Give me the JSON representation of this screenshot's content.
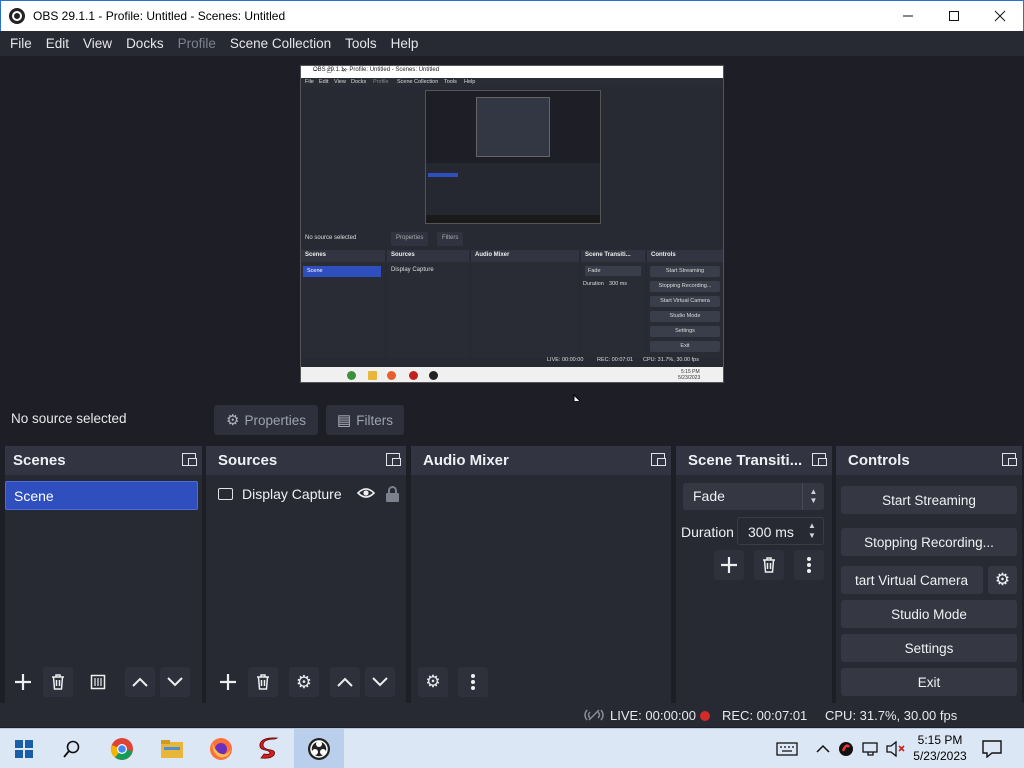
{
  "window": {
    "title": "OBS 29.1.1 - Profile: Untitled - Scenes: Untitled",
    "minimize_icon": "minimize-icon",
    "maximize_icon": "maximize-icon",
    "close_icon": "close-icon"
  },
  "menu": {
    "items": [
      "File",
      "Edit",
      "View",
      "Docks",
      "Profile",
      "Scene Collection",
      "Tools",
      "Help"
    ],
    "disabled": [
      "Profile"
    ]
  },
  "preview": {
    "title": "OBS 29.1.1 - Profile: Untitled - Scenes: Untitled",
    "menu": [
      "File",
      "Edit",
      "View",
      "Docks",
      "Profile",
      "Scene Collection",
      "Tools",
      "Help"
    ],
    "no_source": "No source selected",
    "properties": "Properties",
    "filters": "Filters",
    "docks": {
      "scenes": "Scenes",
      "sources": "Sources",
      "audio_mixer": "Audio Mixer",
      "transitions": "Scene Transiti...",
      "controls": "Controls"
    },
    "scene": "Scene",
    "source": "Display Capture",
    "fade": "Fade",
    "duration_label": "Duration",
    "duration_value": "300 ms",
    "controls": [
      "Start Streaming",
      "Stopping Recording...",
      "Start Virtual Camera",
      "Studio Mode",
      "Settings",
      "Exit"
    ],
    "status": {
      "live": "LIVE: 00:00:00",
      "rec": "REC: 00:07:01",
      "cpu": "CPU: 31.7%, 30.00 fps"
    },
    "clock": {
      "time": "5:15 PM",
      "date": "5/23/2023"
    }
  },
  "source_toolbar": {
    "no_source": "No source selected",
    "properties": "Properties",
    "filters": "Filters"
  },
  "docks": {
    "scenes": {
      "title": "Scenes",
      "items": [
        "Scene"
      ]
    },
    "sources": {
      "title": "Sources",
      "items": [
        {
          "name": "Display Capture",
          "visible": true,
          "locked": false
        }
      ]
    },
    "audio_mixer": {
      "title": "Audio Mixer"
    },
    "transitions": {
      "title": "Scene Transiti...",
      "selected": "Fade",
      "duration_label": "Duration",
      "duration_value": "300 ms"
    },
    "controls": {
      "title": "Controls",
      "start_streaming": "Start Streaming",
      "recording": "Stopping Recording...",
      "virtual_camera": "tart Virtual Camera",
      "studio_mode": "Studio Mode",
      "settings": "Settings",
      "exit": "Exit"
    }
  },
  "status_bar": {
    "live": "LIVE: 00:00:00",
    "rec": "REC: 00:07:01",
    "cpu": "CPU: 31.7%, 30.00 fps",
    "rec_color": "#d32a2a"
  },
  "taskbar": {
    "apps": [
      "windows-start-icon",
      "search-icon",
      "chrome-icon",
      "file-explorer-icon",
      "firefox-icon",
      "streamlabs-icon",
      "obs-icon"
    ],
    "clock": {
      "time": "5:15 PM",
      "date": "5/23/2023"
    },
    "tray": [
      "virtual-keyboard-icon",
      "chevron-up-icon",
      "security-icon",
      "network-icon",
      "volume-muted-icon",
      "notification-icon"
    ]
  },
  "colors": {
    "accent": "#2f4fbf",
    "background": "#1e1f26",
    "panel": "#272a33",
    "dock_header": "#323541",
    "button": "#353843"
  }
}
